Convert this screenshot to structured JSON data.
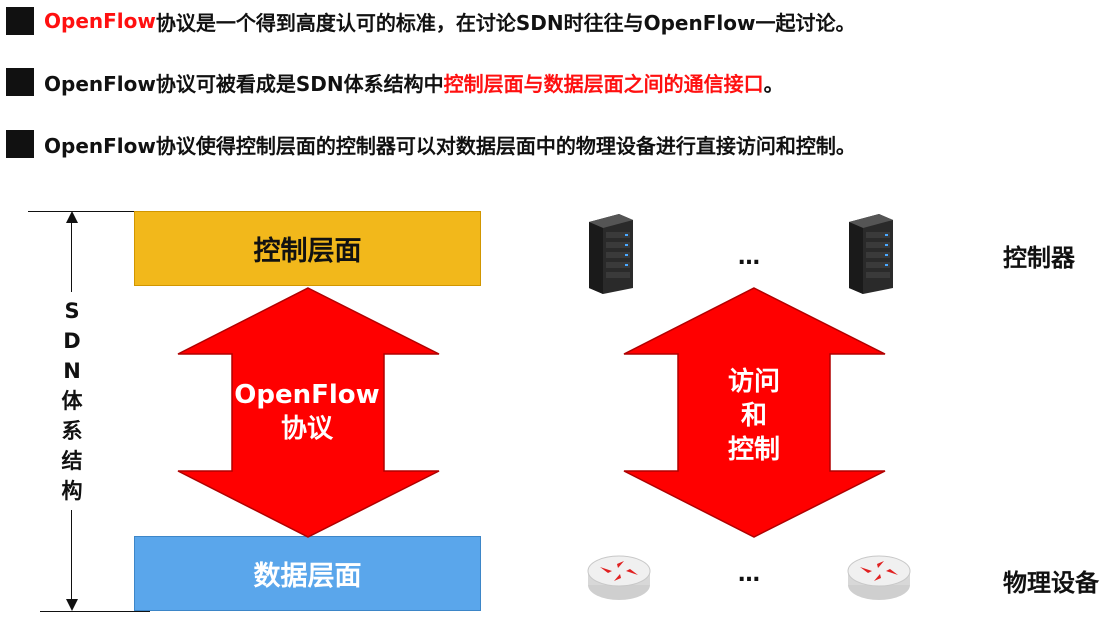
{
  "bullets": [
    {
      "segments": [
        {
          "text": "OpenFlow",
          "color": "red"
        },
        {
          "text": "协议是一个得到高度认可的标准，在讨论SDN时往往与OpenFlow一起讨论。",
          "color": "black"
        }
      ]
    },
    {
      "segments": [
        {
          "text": "OpenFlow协议可被看成是SDN体系结构中",
          "color": "black"
        },
        {
          "text": "控制层面与数据层面之间的通信接口",
          "color": "red"
        },
        {
          "text": "。",
          "color": "black"
        }
      ]
    },
    {
      "segments": [
        {
          "text": "OpenFlow协议使得控制层面的控制器可以对数据层面中的物理设备进行直接访问和控制。",
          "color": "black"
        }
      ]
    }
  ],
  "diagram": {
    "sdn_label_chars": [
      "S",
      "D",
      "N",
      "体",
      "系",
      "结",
      "构"
    ],
    "control_plane": "控制层面",
    "data_plane": "数据层面",
    "openflow_arrow": {
      "line1": "OpenFlow",
      "line2": "协议"
    },
    "access_arrow": {
      "line1": "访问",
      "line2": "和",
      "line3": "控制"
    },
    "controller_label": "控制器",
    "device_label": "物理设备",
    "ellipsis_top": "…",
    "ellipsis_bottom": "…",
    "icons": {
      "server": "server-icon",
      "router": "router-icon"
    },
    "colors": {
      "control_plane": "#f2b81b",
      "data_plane": "#5aa6eb",
      "arrow": "#ff0000"
    }
  }
}
